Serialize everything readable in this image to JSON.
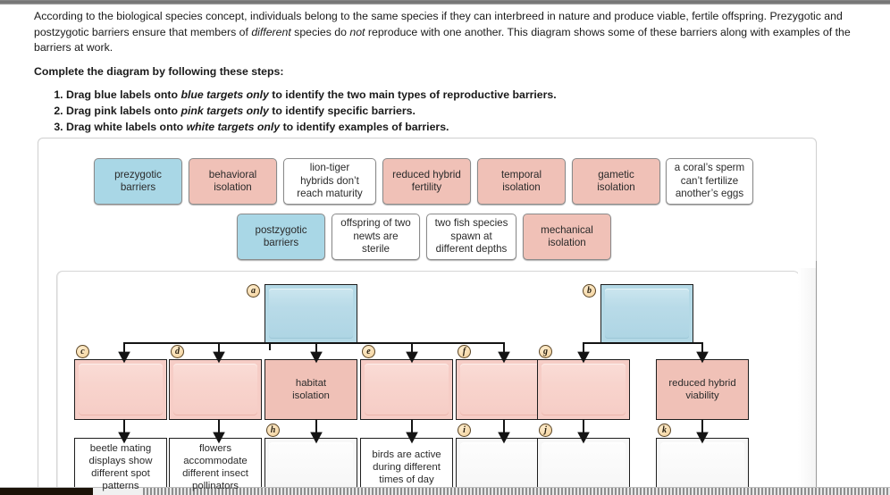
{
  "intro": {
    "para1_a": "According to the biological species concept, individuals belong to the same species if they can interbreed in nature and produce viable, fertile offspring. Prezygotic and postzygotic barriers ensure that members of ",
    "para1_em1": "different",
    "para1_b": " species do ",
    "para1_em2": "not",
    "para1_c": " reproduce with one another. This diagram shows some of these barriers along with examples of the barriers at work.",
    "instructions_heading": "Complete the diagram by following these steps:",
    "steps": [
      {
        "pre": "Drag blue labels onto ",
        "em": "blue targets only",
        "post": " to identify the two main types of reproductive barriers."
      },
      {
        "pre": "Drag pink labels onto ",
        "em": "pink targets only",
        "post": " to identify specific barriers."
      },
      {
        "pre": "Drag white labels onto ",
        "em": "white targets only",
        "post": " to identify examples of barriers."
      }
    ]
  },
  "colors": {
    "blue": "#a9d7e6",
    "pink": "#f0c1b7",
    "pink_empty": "#f6cdc6",
    "white": "#ffffff",
    "marker": "#f7dcaf",
    "border": "#8a8a8a"
  },
  "label_bank": {
    "row1": [
      {
        "text": "prezygotic\nbarriers",
        "kind": "blue"
      },
      {
        "text": "behavioral\nisolation",
        "kind": "pink"
      },
      {
        "text": "lion-tiger\nhybrids don’t\nreach maturity",
        "kind": "white"
      },
      {
        "text": "reduced hybrid\nfertility",
        "kind": "pink"
      },
      {
        "text": "temporal\nisolation",
        "kind": "pink"
      },
      {
        "text": "gametic\nisolation",
        "kind": "pink"
      },
      {
        "text": "a coral’s sperm\ncan’t fertilize\nanother’s eggs",
        "kind": "white"
      }
    ],
    "row2": [
      {
        "text": "postzygotic\nbarriers",
        "kind": "blue"
      },
      {
        "text": "offspring of two\nnewts are\nsterile",
        "kind": "white"
      },
      {
        "text": "two fish species\nspawn at\ndifferent depths",
        "kind": "white"
      },
      {
        "text": "mechanical\nisolation",
        "kind": "pink"
      }
    ]
  },
  "diagram": {
    "targets": {
      "a": {
        "marker": "a",
        "kind": "blue-empty",
        "text": ""
      },
      "b": {
        "marker": "b",
        "kind": "blue-empty",
        "text": ""
      },
      "c": {
        "marker": "c",
        "kind": "pink-empty",
        "text": ""
      },
      "d": {
        "marker": "d",
        "kind": "pink-empty",
        "text": ""
      },
      "habitat": {
        "marker": "",
        "kind": "pink-filled",
        "text": "habitat\nisolation"
      },
      "e": {
        "marker": "e",
        "kind": "pink-empty",
        "text": ""
      },
      "f": {
        "marker": "f",
        "kind": "pink-empty",
        "text": ""
      },
      "g": {
        "marker": "g",
        "kind": "pink-empty",
        "text": ""
      },
      "viability": {
        "marker": "",
        "kind": "pink-filled",
        "text": "reduced hybrid\nviability"
      },
      "beetle": {
        "marker": "",
        "kind": "white-filled",
        "text": "beetle mating\ndisplays show\ndifferent spot\npatterns"
      },
      "flowers": {
        "marker": "",
        "kind": "white-filled",
        "text": "flowers\naccommodate\ndifferent insect\npollinators"
      },
      "h": {
        "marker": "h",
        "kind": "white-empty",
        "text": ""
      },
      "birds": {
        "marker": "",
        "kind": "white-filled",
        "text": "birds are active\nduring different\ntimes of day"
      },
      "i": {
        "marker": "i",
        "kind": "white-empty",
        "text": ""
      },
      "j": {
        "marker": "j",
        "kind": "white-empty",
        "text": ""
      },
      "k": {
        "marker": "k",
        "kind": "white-empty",
        "text": ""
      }
    }
  }
}
